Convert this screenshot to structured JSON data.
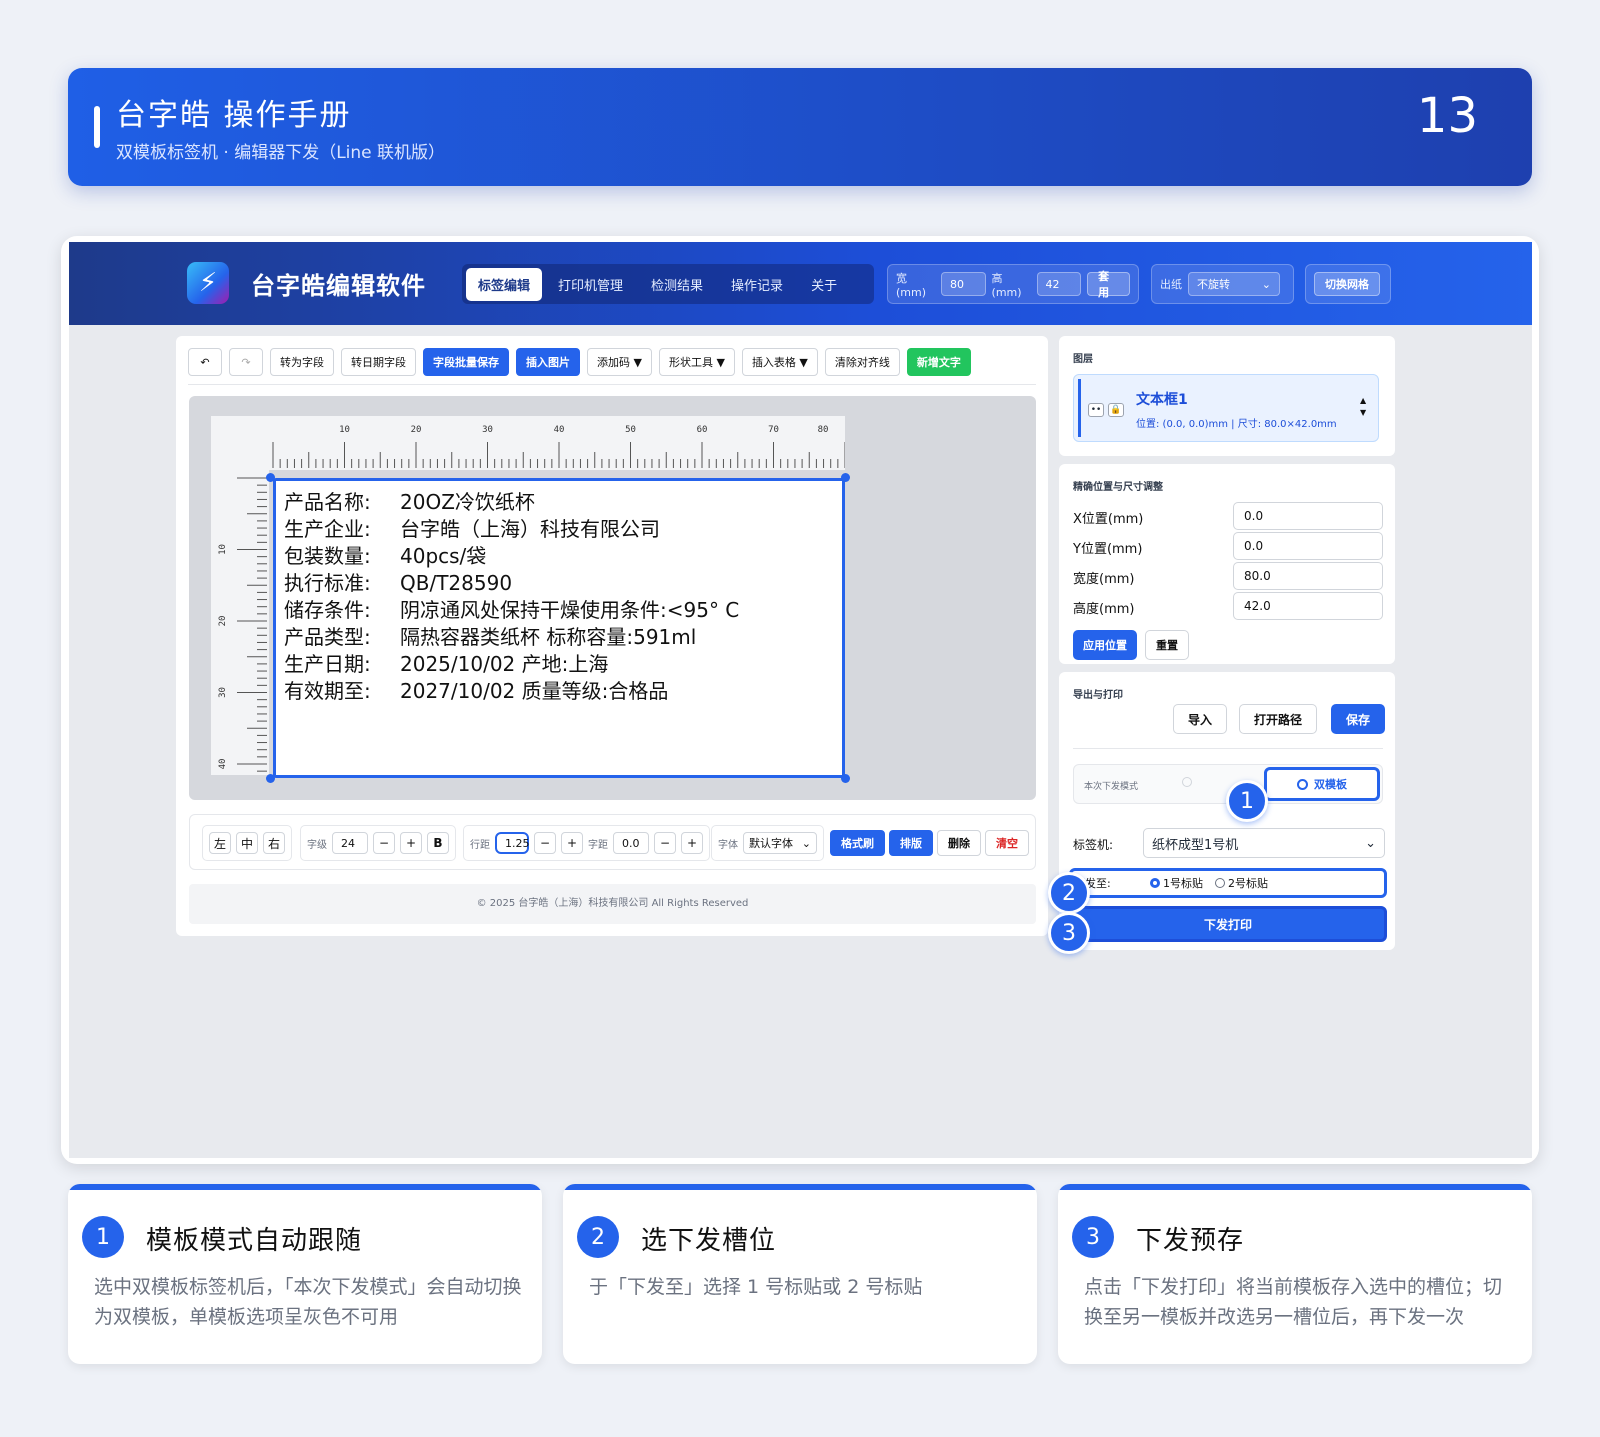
{
  "header": {
    "title": "台字皓 操作手册",
    "subtitle": "双模板标签机 · 编辑器下发（Line 联机版）",
    "page_number": "13"
  },
  "app": {
    "title": "台字皓编辑软件",
    "nav": [
      "标签编辑",
      "打印机管理",
      "检测结果",
      "操作记录",
      "关于"
    ],
    "size_group": {
      "width_label": "宽(mm)",
      "width_value": "80",
      "height_label": "高(mm)",
      "height_value": "42",
      "apply": "套用"
    },
    "paper_group": {
      "label": "出纸",
      "value": "不旋转"
    },
    "grid_button": "切换网格",
    "toolbar": {
      "undo": "↶",
      "redo": "↷",
      "items": [
        "转为字段",
        "转日期字段",
        "字段批量保存",
        "插入图片",
        "添加码 ▼",
        "形状工具 ▼",
        "插入表格 ▼",
        "清除对齐线",
        "新增文字"
      ]
    },
    "ruler": {
      "top": [
        "10",
        "20",
        "30",
        "40",
        "50",
        "60",
        "70",
        "80"
      ],
      "left": [
        "10",
        "20",
        "30",
        "40"
      ]
    },
    "label_lines": [
      {
        "k": "产品名称:",
        "v": "20OZ冷饮纸杯"
      },
      {
        "k": "生产企业:",
        "v": "台字皓（上海）科技有限公司"
      },
      {
        "k": "包装数量:",
        "v": "40pcs/袋"
      },
      {
        "k": "执行标准:",
        "v": "QB/T28590"
      },
      {
        "k": "储存条件:",
        "v": "阴凉通风处保持干燥使用条件:<95° C"
      },
      {
        "k": "产品类型:",
        "v": "隔热容器类纸杯 标称容量:591ml"
      },
      {
        "k": "生产日期:",
        "v": "2025/10/02 产地:上海"
      },
      {
        "k": "有效期至:",
        "v": "2027/10/02 质量等级:合格品"
      }
    ],
    "format": {
      "align": [
        "左",
        "中",
        "右"
      ],
      "size_label": "字级",
      "size_value": "24",
      "minus": "−",
      "plus": "+",
      "bold": "B",
      "line_label": "行距",
      "line_value": "1.25",
      "spacing_label": "字距",
      "spacing_value": "0.0",
      "font_label": "字体",
      "font_value": "默认字体",
      "painter": "格式刷",
      "layout": "排版",
      "delete": "删除",
      "clear": "清空"
    },
    "footer": "© 2025 台字皓（上海）科技有限公司 All Rights Reserved",
    "layers": {
      "title": "图层",
      "item_name": "文本框1",
      "item_info": "位置: (0.0, 0.0)mm | 尺寸: 80.0×42.0mm"
    },
    "position": {
      "title": "精确位置与尺寸调整",
      "fields": [
        {
          "label": "X位置(mm)",
          "value": "0.0"
        },
        {
          "label": "Y位置(mm)",
          "value": "0.0"
        },
        {
          "label": "宽度(mm)",
          "value": "80.0"
        },
        {
          "label": "高度(mm)",
          "value": "42.0"
        }
      ],
      "apply": "应用位置",
      "reset": "重置"
    },
    "export": {
      "title": "导出与打印",
      "import": "导入",
      "open_path": "打开路径",
      "save": "保存",
      "mode_label": "本次下发模式",
      "mode_double": "双模板",
      "printer_label": "标签机:",
      "printer_value": "纸杯成型1号机",
      "slot_label": "下发至:",
      "slot1": "1号标贴",
      "slot2": "2号标贴",
      "print_button": "下发打印"
    }
  },
  "markers": [
    "1",
    "2",
    "3"
  ],
  "cards": [
    {
      "num": "1",
      "title": "模板模式自动跟随",
      "desc": "选中双模板标签机后，「本次下发模式」会自动切换为双模板，单模板选项呈灰色不可用"
    },
    {
      "num": "2",
      "title": "选下发槽位",
      "desc": "于「下发至」选择 1 号标贴或 2 号标贴"
    },
    {
      "num": "3",
      "title": "下发预存",
      "desc": "点击「下发打印」将当前模板存入选中的槽位；切换至另一模板并改选另一槽位后，再下发一次"
    }
  ]
}
